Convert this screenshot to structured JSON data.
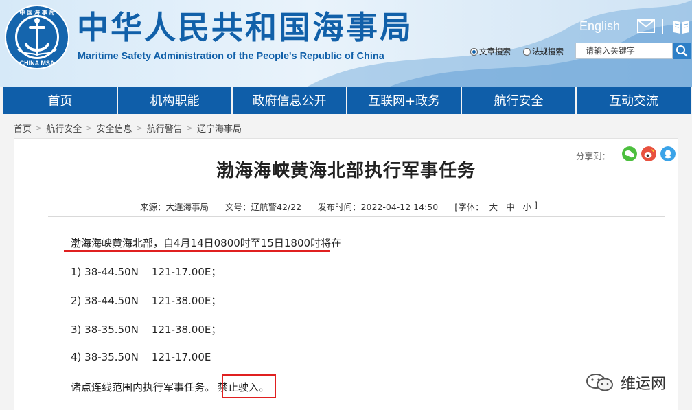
{
  "header": {
    "title_cn": "中华人民共和国海事局",
    "title_en": "Maritime Safety Administration of the People's Republic of China",
    "logo_text_top": "中 国 海 事 局",
    "logo_text_bottom": "CHINA MSA",
    "english_link": "English",
    "search": {
      "option_article": "文章搜索",
      "option_law": "法规搜索",
      "placeholder": "请输入关键字",
      "selected": "文章搜索"
    },
    "brand_color": "#1160a9"
  },
  "nav": {
    "items": [
      "首页",
      "机构职能",
      "政府信息公开",
      "互联网+政务",
      "航行安全",
      "互动交流"
    ],
    "color": "#0f5ea9"
  },
  "breadcrumb": [
    "首页",
    "航行安全",
    "安全信息",
    "航行警告",
    "辽宁海事局"
  ],
  "share": {
    "label": "分享到：",
    "icons": [
      "wechat-icon",
      "weibo-icon",
      "qq-icon"
    ]
  },
  "article": {
    "title": "渤海海峡黄海北部执行军事任务",
    "meta": {
      "source": "来源：大连海事局",
      "doc_no": "文号：辽航警42/22",
      "publish_time": "发布时间：2022-04-12 14:50",
      "font_size_label": "[字体：",
      "font_large": "大",
      "font_medium": "中",
      "font_small": "小",
      "font_close": "]"
    },
    "paragraphs": [
      "渤海海峡黄海北部，自4月14日0800时至15日1800时将在",
      "1) 38-44.50N    121-17.00E；",
      "2) 38-44.50N    121-38.00E；",
      "3) 38-35.50N    121-38.00E；",
      "4) 38-35.50N    121-17.00E"
    ],
    "last_line_prefix": "诸点连线范围内执行军事任务。",
    "last_line_highlight": "禁止驶入。",
    "highlight_color": "#e02020"
  },
  "watermark": "维运网"
}
